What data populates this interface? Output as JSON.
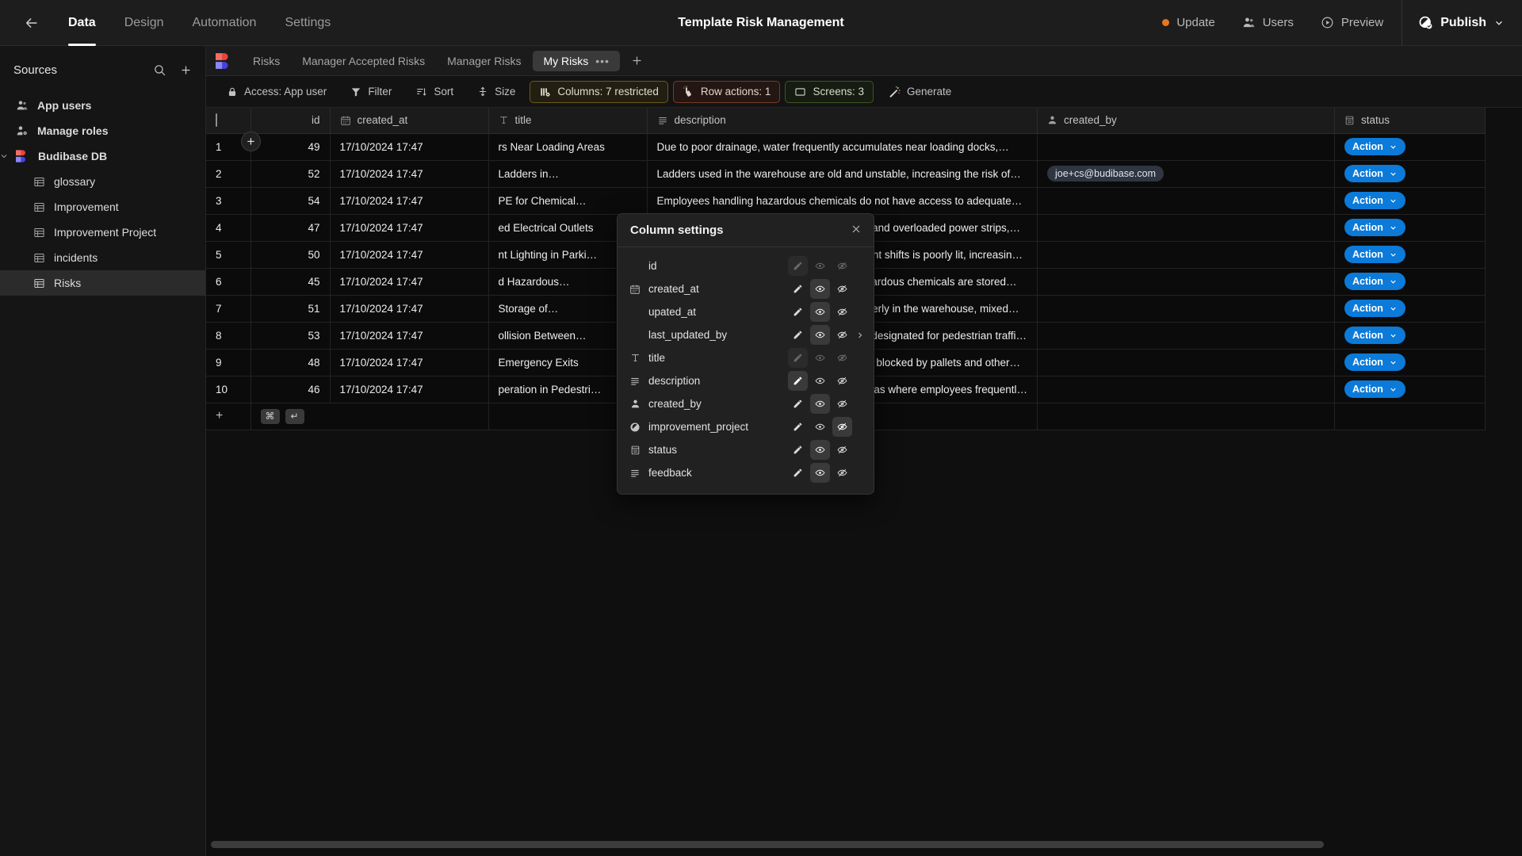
{
  "topbar": {
    "back_icon": "arrow-left-icon",
    "nav": [
      {
        "label": "Data",
        "active": true
      },
      {
        "label": "Design",
        "active": false
      },
      {
        "label": "Automation",
        "active": false
      },
      {
        "label": "Settings",
        "active": false
      }
    ],
    "app_title": "Template Risk Management",
    "update_label": "Update",
    "users_label": "Users",
    "preview_label": "Preview",
    "publish_label": "Publish",
    "update_dot_color": "#e8761f"
  },
  "sidebar": {
    "title": "Sources",
    "search_icon": "search-icon",
    "add_icon": "plus-icon",
    "items": [
      {
        "label": "App users",
        "icon": "users-icon",
        "level": 0,
        "selected": false
      },
      {
        "label": "Manage roles",
        "icon": "user-gear-icon",
        "level": 0,
        "selected": false
      },
      {
        "label": "Budibase DB",
        "icon": "budibase-logo-icon",
        "level": 0,
        "selected": false,
        "expanded": true
      },
      {
        "label": "glossary",
        "icon": "table-icon",
        "level": 1,
        "selected": false
      },
      {
        "label": "Improvement",
        "icon": "table-icon",
        "level": 1,
        "selected": false
      },
      {
        "label": "Improvement Project",
        "icon": "table-icon",
        "level": 1,
        "selected": false
      },
      {
        "label": "incidents",
        "icon": "table-icon",
        "level": 1,
        "selected": false
      },
      {
        "label": "Risks",
        "icon": "table-icon",
        "level": 1,
        "selected": true
      }
    ]
  },
  "view_tabs": {
    "logo_icon": "budibase-logo-icon",
    "tabs": [
      {
        "label": "Risks",
        "active": false
      },
      {
        "label": "Manager Accepted Risks",
        "active": false
      },
      {
        "label": "Manager Risks",
        "active": false
      },
      {
        "label": "My Risks",
        "active": true,
        "menu": "•••"
      }
    ],
    "add_tab_label": "+"
  },
  "toolbar": {
    "access_label": "Access: App user",
    "filter_label": "Filter",
    "sort_label": "Sort",
    "size_label": "Size",
    "columns_label": "Columns: 7 restricted",
    "row_actions_label": "Row actions: 1",
    "screens_label": "Screens: 3",
    "generate_label": "Generate"
  },
  "column_settings": {
    "title": "Column settings",
    "close_icon": "close-icon",
    "rows": [
      {
        "name": "id",
        "icon": "",
        "edit": "disabled-on",
        "visible": "off",
        "hidden": "off",
        "chevron": false
      },
      {
        "name": "created_at",
        "icon": "calendar-icon",
        "edit": "off",
        "visible": "on",
        "hidden": "off",
        "chevron": false
      },
      {
        "name": "upated_at",
        "icon": "",
        "edit": "off",
        "visible": "on",
        "hidden": "off",
        "chevron": false
      },
      {
        "name": "last_updated_by",
        "icon": "",
        "edit": "off",
        "visible": "on",
        "hidden": "off",
        "chevron": true
      },
      {
        "name": "title",
        "icon": "text-icon",
        "edit": "disabled-on",
        "visible": "off",
        "hidden": "off",
        "chevron": false
      },
      {
        "name": "description",
        "icon": "longform-icon",
        "edit": "on",
        "visible": "off",
        "hidden": "off",
        "chevron": false
      },
      {
        "name": "created_by",
        "icon": "user-icon",
        "edit": "off",
        "visible": "on",
        "hidden": "off",
        "chevron": false
      },
      {
        "name": "improvement_project",
        "icon": "relationship-icon",
        "edit": "off",
        "visible": "off",
        "hidden": "on",
        "chevron": false
      },
      {
        "name": "status",
        "icon": "options-icon",
        "edit": "off",
        "visible": "on",
        "hidden": "off",
        "chevron": false
      },
      {
        "name": "feedback",
        "icon": "longform-icon",
        "edit": "off",
        "visible": "on",
        "hidden": "off",
        "chevron": false
      }
    ]
  },
  "grid": {
    "headers": [
      {
        "key": "select",
        "label": "",
        "icon": "checkbox-icon"
      },
      {
        "key": "id",
        "label": "id",
        "icon": ""
      },
      {
        "key": "created_at",
        "label": "created_at",
        "icon": "calendar-icon"
      },
      {
        "key": "title",
        "label": "title",
        "icon": "text-icon"
      },
      {
        "key": "description",
        "label": "description",
        "icon": "longform-icon"
      },
      {
        "key": "created_by",
        "label": "created_by",
        "icon": "user-icon"
      },
      {
        "key": "status",
        "label": "status",
        "icon": "options-icon"
      }
    ],
    "rows": [
      {
        "n": "1",
        "id": "49",
        "created_at": "17/10/2024 17:47",
        "title": "rs Near Loading Areas",
        "description": "Due to poor drainage, water frequently accumulates near loading docks,…",
        "created_by": "",
        "status": "Action"
      },
      {
        "n": "2",
        "id": "52",
        "created_at": "17/10/2024 17:47",
        "title": "Ladders in…",
        "description": "Ladders used in the warehouse are old and unstable, increasing the risk of…",
        "created_by": "joe+cs@budibase.com",
        "status": "Action"
      },
      {
        "n": "3",
        "id": "54",
        "created_at": "17/10/2024 17:47",
        "title": "PE for Chemical…",
        "description": "Employees handling hazardous chemicals do not have access to adequate…",
        "created_by": "",
        "status": "Action"
      },
      {
        "n": "4",
        "id": "47",
        "created_at": "17/10/2024 17:47",
        "title": "ed Electrical Outlets",
        "description": "Multiple workstations rely on extension cords and overloaded power strips,…",
        "created_by": "",
        "status": "Action"
      },
      {
        "n": "5",
        "id": "50",
        "created_at": "17/10/2024 17:47",
        "title": "nt Lighting in Parki…",
        "description": "The parking lot used by employees during night shifts is poorly lit, increasin…",
        "created_by": "",
        "status": "Action"
      },
      {
        "n": "6",
        "id": "45",
        "created_at": "17/10/2024 17:47",
        "title": "d Hazardous…",
        "description": "In the storage area, several containers of hazardous chemicals are stored…",
        "created_by": "",
        "status": "Action"
      },
      {
        "n": "7",
        "id": "51",
        "created_at": "17/10/2024 17:47",
        "title": "Storage of…",
        "description": "Flammable materials are being stored improperly in the warehouse, mixed…",
        "created_by": "",
        "status": "Action"
      },
      {
        "n": "8",
        "id": "53",
        "created_at": "17/10/2024 17:47",
        "title": "ollision Between…",
        "description": "There is no clear segregation between areas designated for pedestrian traffi…",
        "created_by": "",
        "status": "Action"
      },
      {
        "n": "9",
        "id": "48",
        "created_at": "17/10/2024 17:47",
        "title": "Emergency Exits",
        "description": "During peak hours, emergency exits are often blocked by pallets and other…",
        "created_by": "",
        "status": "Action"
      },
      {
        "n": "10",
        "id": "46",
        "created_at": "17/10/2024 17:47",
        "title": "peration in Pedestri…",
        "description": "Forklifts are often driven at high speeds in areas where employees frequentl…",
        "created_by": "",
        "status": "Action"
      }
    ],
    "add_row": {
      "plus": "+",
      "kbd_cmd": "⌘",
      "kbd_enter": "↵"
    },
    "action_accent": "#0b7ad8"
  }
}
